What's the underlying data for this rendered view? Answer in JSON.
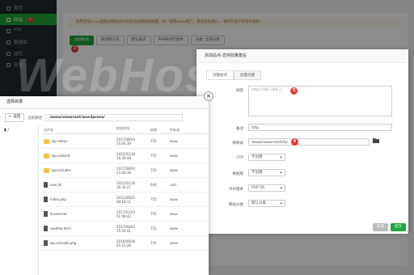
{
  "sidebar": {
    "items": [
      {
        "label": "首页",
        "icon": "home-icon"
      },
      {
        "label": "网站",
        "icon": "globe-icon",
        "badge": "1",
        "active": true
      },
      {
        "label": "FTP",
        "icon": "ftp-icon"
      },
      {
        "label": "数据库",
        "icon": "database-icon"
      },
      {
        "label": "监控",
        "icon": "monitor-icon"
      },
      {
        "label": "安全",
        "icon": "shield-icon"
      }
    ]
  },
  "main": {
    "notice": "使用宝塔Linux面板创建站点时会自动创建权限配置，统一使用www用户，建站前先确认… 请勿在生产环境中删除 …",
    "toolbar": [
      "添加站点",
      "修改默认页",
      "默认站点",
      "PHP命令行版本",
      "分类: 全部分类"
    ],
    "marker_2": "2"
  },
  "watermark": {
    "text": "WebHosting",
    "cn": "中文"
  },
  "add_site_modal": {
    "title": "添加站点-支持批量建站",
    "tabs": [
      "创建站点",
      "批量创建"
    ],
    "domain_label": "域名",
    "domain_value": "http://192.168.1...",
    "marker_3": "3",
    "note_label": "备注",
    "note_value": "http",
    "root_label": "根目录",
    "root_value": "/www/wwwroot/http",
    "marker_4": "4",
    "ftp_label": "FTP",
    "ftp_value": "不创建",
    "db_label": "数据库",
    "db_value": "不创建",
    "php_label": "PHP版本",
    "php_value": "PHP-56",
    "category_label": "网站分类",
    "category_value": "默认分类",
    "cancel": "取消",
    "submit": "提交"
  },
  "file_modal": {
    "title": "选择目录",
    "back": "返回",
    "path_label": "当前路径",
    "path_value": "/www/wwwroot/wordpress/",
    "drive": "/",
    "columns": [
      "文件名",
      "修改时间",
      "权限",
      "所有者"
    ],
    "rows": [
      {
        "name": "wp-admin",
        "type": "folder",
        "time1": "2017/08/04",
        "time2": "15:04:39",
        "perm": "755",
        "owner": "www"
      },
      {
        "name": "wp-content",
        "type": "folder",
        "time1": "2021/02/18",
        "time2": "16:30:48",
        "perm": "755",
        "owner": "www"
      },
      {
        "name": "wp-includes",
        "type": "folder",
        "time1": "2017/08/04",
        "time2": "15:04:18",
        "perm": "755",
        "owner": "www"
      },
      {
        "name": "user.ini",
        "type": "file",
        "time1": "2021/02/18",
        "time2": "16:32:27",
        "perm": "644",
        "owner": "root"
      },
      {
        "name": "index.php",
        "type": "file",
        "time1": "2011/09/25",
        "time2": "08:18:11",
        "perm": "755",
        "owner": "www"
      },
      {
        "name": "license.txt",
        "type": "file",
        "time1": "2017/01/03",
        "time2": "01:08:42",
        "perm": "755",
        "owner": "www"
      },
      {
        "name": "readme.html",
        "type": "file",
        "time1": "2017/08/04",
        "time2": "15:54:41",
        "perm": "755",
        "owner": "www"
      },
      {
        "name": "wp-activate.php",
        "type": "file",
        "time1": "2016/09/28",
        "time2": "05:16:28",
        "perm": "755",
        "owner": "www"
      }
    ]
  }
}
